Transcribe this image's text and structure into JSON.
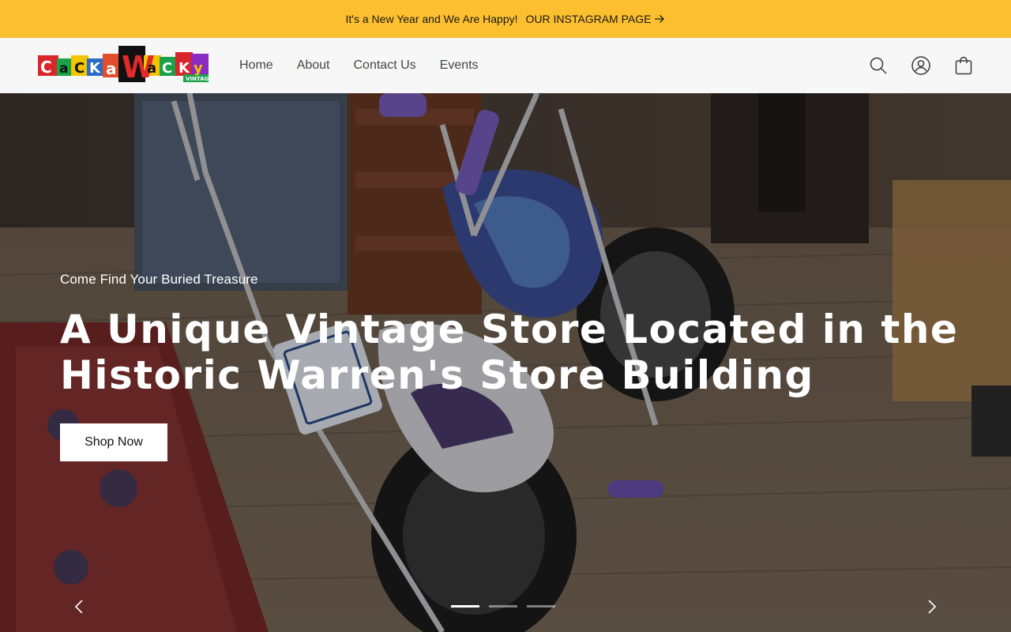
{
  "announcement": {
    "message": "It's a New Year and We Are Happy!",
    "link_label": "OUR INSTAGRAM PAGE",
    "bg_color": "#fcbf2f"
  },
  "header": {
    "logo": {
      "text": "CackaWacky",
      "tag": "VINTAGE"
    },
    "nav": [
      {
        "label": "Home"
      },
      {
        "label": "About"
      },
      {
        "label": "Contact Us"
      },
      {
        "label": "Events"
      }
    ],
    "icons": [
      "search-icon",
      "account-icon",
      "cart-icon"
    ]
  },
  "hero": {
    "kicker": "Come Find Your Buried Treasure",
    "headline": "A Unique Vintage Store Located in the Historic Warren's Store Building",
    "button_label": "Shop Now",
    "slides": 3,
    "active_slide": 1
  }
}
